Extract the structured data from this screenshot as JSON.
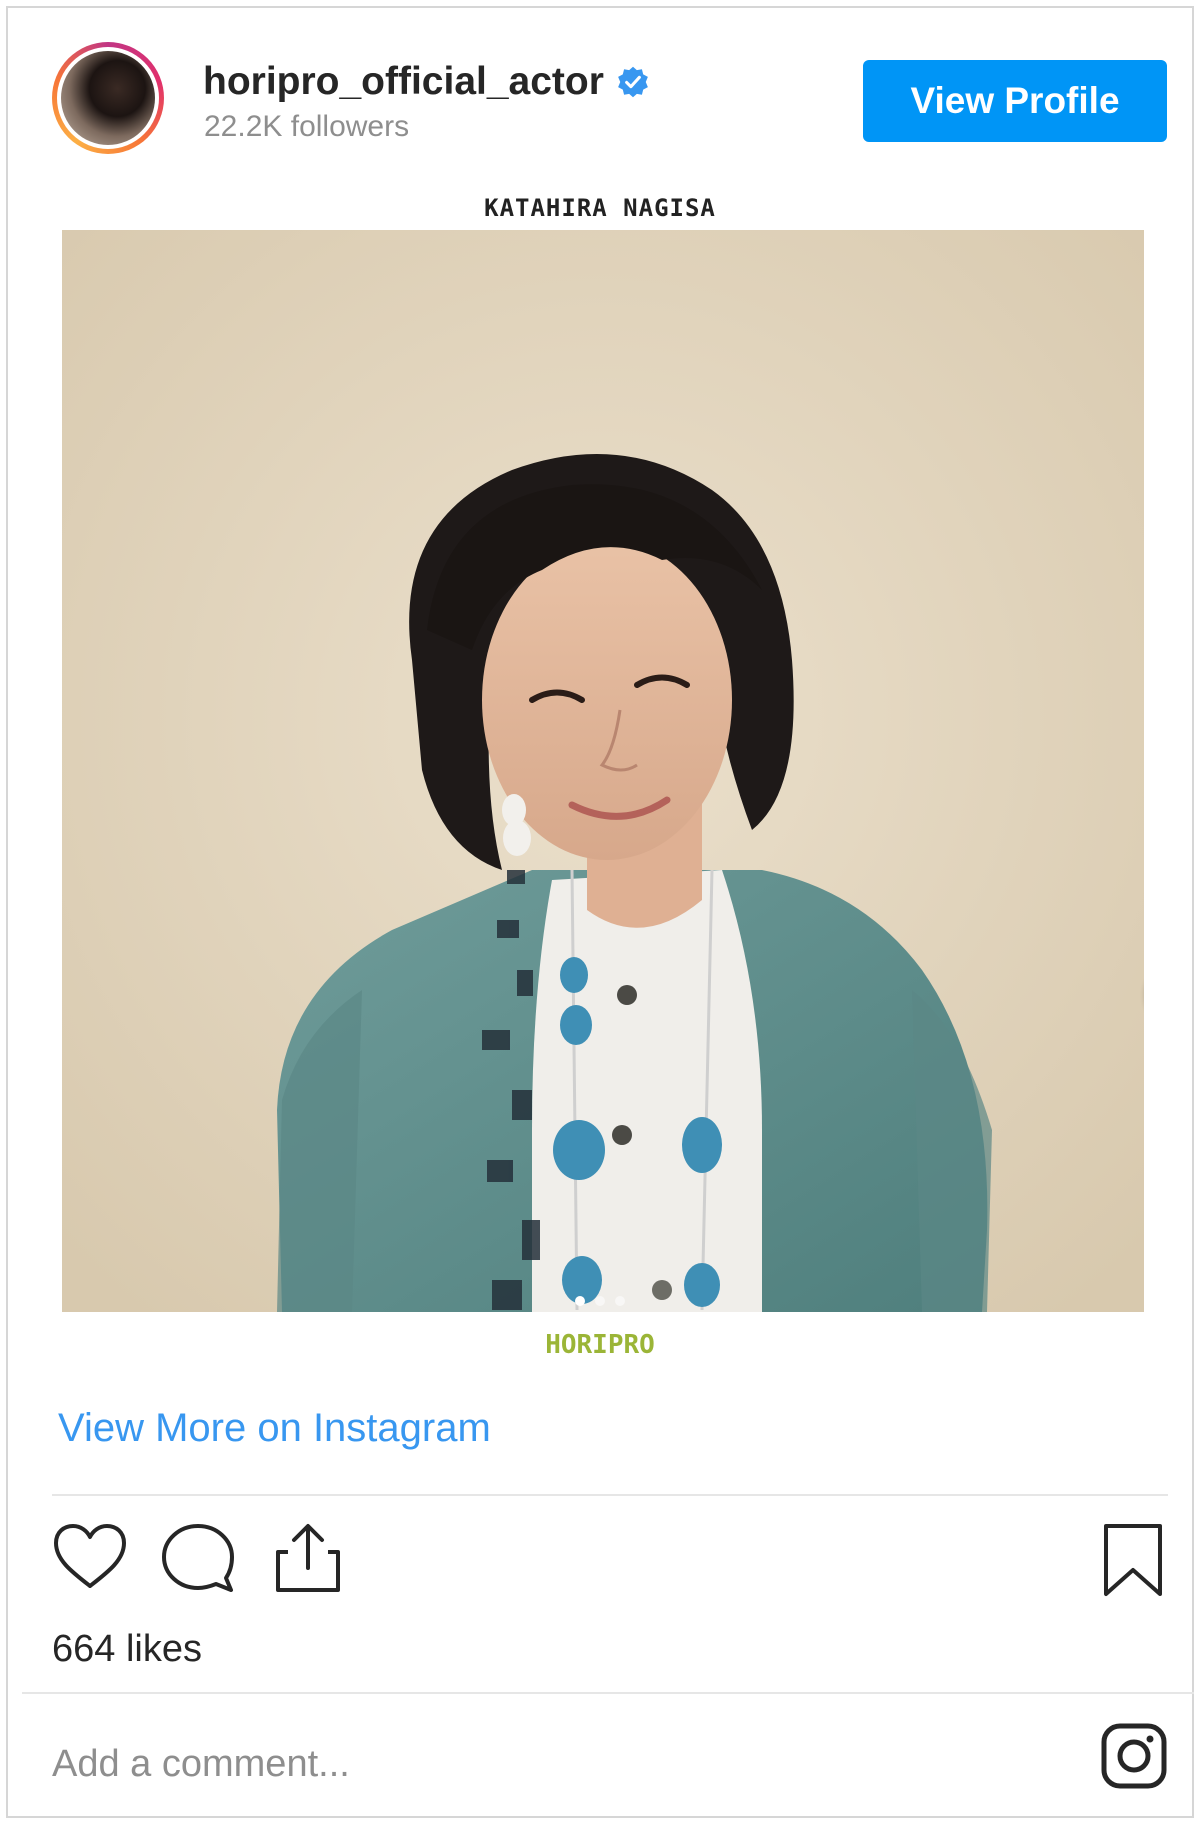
{
  "header": {
    "username": "horipro_official_actor",
    "followers": "22.2K followers",
    "verified": true,
    "view_profile_label": "View Profile"
  },
  "post": {
    "caption_top": "KATAHIRA NAGISA",
    "caption_bottom": "HORIPRO",
    "carousel": {
      "current": 1,
      "total": 3
    }
  },
  "links": {
    "view_more": "View More on Instagram"
  },
  "actions": {
    "icons": [
      "heart-icon",
      "comment-icon",
      "share-icon",
      "bookmark-icon"
    ],
    "likes": "664 likes"
  },
  "comment": {
    "placeholder": "Add a comment..."
  },
  "colors": {
    "accent": "#0095f6",
    "link": "#3897f0",
    "brand_text": "#9bb537"
  }
}
